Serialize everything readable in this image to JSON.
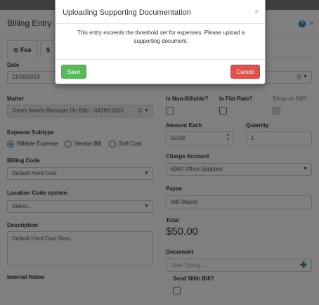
{
  "panel": {
    "title": "Billing Entry",
    "help_icon": "question-circle-icon",
    "close_glyph": "×",
    "tabs": [
      {
        "icon": "clock-icon",
        "glyph": "⊙",
        "label": "Fee"
      },
      {
        "icon": "dollar-icon",
        "glyph": "$",
        "label": ""
      }
    ]
  },
  "form": {
    "date": {
      "label": "Date",
      "value": "11/08/2023"
    },
    "matter": {
      "label": "Matter",
      "value": "Jones Needs Receipts On Bills - 04289.0001"
    },
    "is_non_billable": {
      "label": "Is Non-Billable?"
    },
    "is_flat_rate": {
      "label": "Is Flat Rate?"
    },
    "show_on_bill": {
      "label": "Show on Bill?"
    },
    "expense_subtype": {
      "label": "Expense Subtype",
      "options": [
        "Billable Expense",
        "Vendor Bill",
        "Soft Cost"
      ],
      "selected": "Billable Expense"
    },
    "amount_each": {
      "label": "Amount Each",
      "value": "50.00"
    },
    "quantity": {
      "label": "Quantity",
      "value": "1"
    },
    "billing_code": {
      "label": "Billing Code",
      "value": "Default Hard Cost"
    },
    "charge_account": {
      "label": "Charge Account",
      "value": "6000 Office Supplies"
    },
    "location_code": {
      "label": "Location Code system",
      "value": "Select..."
    },
    "payee": {
      "label": "Payee",
      "value": "WB Mason"
    },
    "total": {
      "label": "Total",
      "value": "$50.00"
    },
    "description": {
      "label": "Description",
      "value": "Default Hard Cost Desc."
    },
    "document": {
      "label": "Document",
      "placeholder": "Start Typing..."
    },
    "internal_notes": {
      "label": "Internal Notes"
    },
    "send_with_bill": {
      "label": "Send With Bill?"
    }
  },
  "modal": {
    "title": "Uploading Supporting Documentation",
    "close_glyph": "×",
    "message": "This entry exceeds the threshold set for expenses. Please upload a supporting document.",
    "save_label": "Save",
    "cancel_label": "Cancel"
  },
  "colors": {
    "save": "#5cb85c",
    "cancel": "#d9534f",
    "link": "#337ab7",
    "add": "#2a9d3d"
  }
}
